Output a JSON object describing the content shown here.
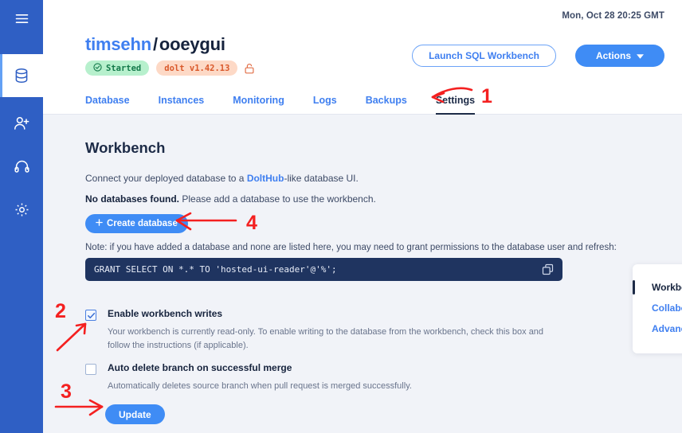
{
  "sidebar": {
    "items": [
      {
        "label": "menu",
        "icon": "hamburger-icon"
      },
      {
        "label": "deployments",
        "icon": "database-icon"
      },
      {
        "label": "team",
        "icon": "add-user-icon"
      },
      {
        "label": "support",
        "icon": "headset-icon"
      },
      {
        "label": "settings",
        "icon": "gear-icon"
      }
    ]
  },
  "header": {
    "timestamp": "Mon, Oct 28 20:25 GMT",
    "owner": "timsehn",
    "separator": "/",
    "repo": "ooeygui",
    "badges": {
      "status": "Started",
      "status_icon": "check-circle-icon",
      "version": "dolt v1.42.13",
      "lock_icon": "unlock-icon"
    },
    "buttons": {
      "launch": "Launch SQL Workbench",
      "actions": "Actions",
      "actions_caret": "caret-down-icon"
    }
  },
  "tabs": [
    {
      "label": "Database",
      "active": false
    },
    {
      "label": "Instances",
      "active": false
    },
    {
      "label": "Monitoring",
      "active": false
    },
    {
      "label": "Logs",
      "active": false
    },
    {
      "label": "Backups",
      "active": false
    },
    {
      "label": "Settings",
      "active": true
    }
  ],
  "main": {
    "title": "Workbench",
    "connect_prefix": "Connect your deployed database to a ",
    "connect_link": "DoltHub",
    "connect_suffix": "-like database UI.",
    "nodb_bold": "No databases found.",
    "nodb_rest": " Please add a database to use the workbench.",
    "create_button": "Create database",
    "create_icon": "plus-icon",
    "note": "Note: if you have added a database and none are listed here, you may need to grant permissions to the database user and refresh:",
    "code": "GRANT SELECT ON *.* TO 'hosted-ui-reader'@'%';",
    "copy_icon": "copy-icon",
    "checkboxes": [
      {
        "label": "Enable workbench writes",
        "checked": true,
        "description": "Your workbench is currently read-only. To enable writing to the database from the workbench, check this box and follow the instructions (if applicable)."
      },
      {
        "label": "Auto delete branch on successful merge",
        "checked": false,
        "description": "Automatically deletes source branch when pull request is merged successfully."
      }
    ],
    "update_button": "Update"
  },
  "side_panel": {
    "items": [
      {
        "label": "Workbench",
        "active": true
      },
      {
        "label": "Collaborators",
        "active": false
      },
      {
        "label": "Advanced",
        "active": false
      }
    ]
  },
  "annotations": {
    "color": "#f42020",
    "markers": [
      {
        "text": "1",
        "target": "settings-tab"
      },
      {
        "text": "2",
        "target": "enable-workbench-writes-checkbox"
      },
      {
        "text": "3",
        "target": "update-button"
      },
      {
        "text": "4",
        "target": "create-database-button"
      }
    ]
  },
  "colors": {
    "rail": "#2f5fc4",
    "accent_blue": "#3f8cf5",
    "link_blue": "#3f7ff0",
    "dark_navy": "#1d2b47",
    "code_bg": "#1f3460",
    "main_bg": "#f1f3f8",
    "badge_green_bg": "#b7f0cd",
    "badge_green_fg": "#13794a",
    "badge_peach_bg": "#fdd9c6",
    "badge_peach_fg": "#d9582a",
    "annotation_red": "#f42020"
  }
}
